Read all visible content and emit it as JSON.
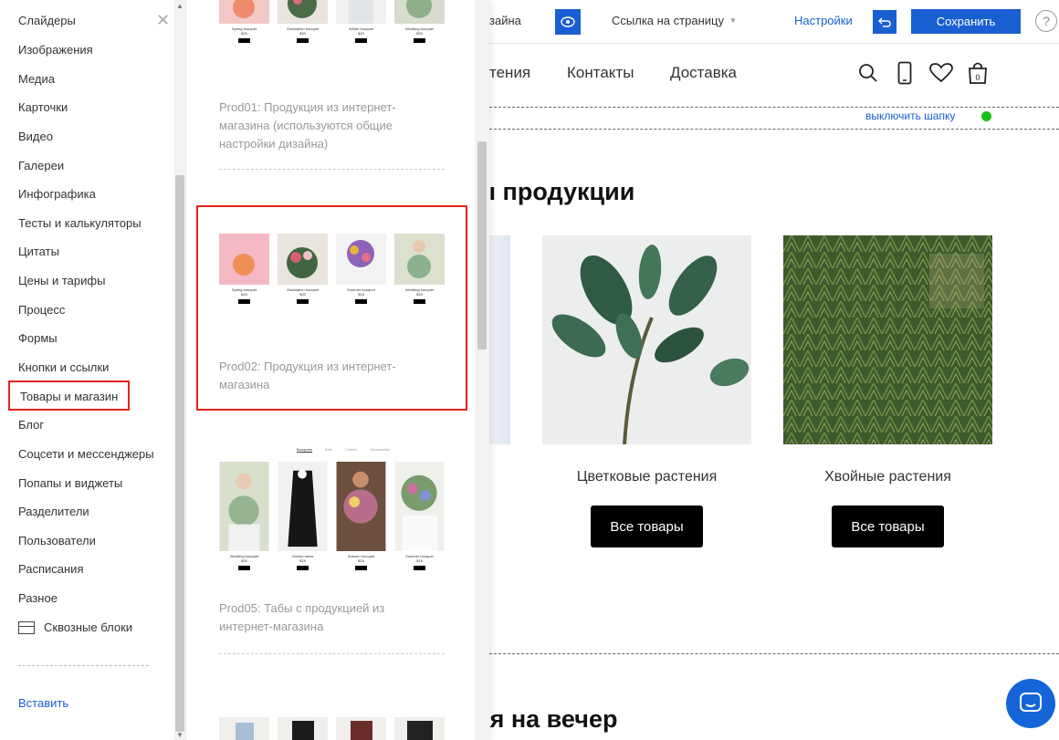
{
  "sidebar": {
    "categories": [
      "Слайдеры",
      "Изображения",
      "Медиа",
      "Карточки",
      "Видео",
      "Галереи",
      "Инфографика",
      "Тесты и калькуляторы",
      "Цитаты",
      "Цены и тарифы",
      "Процесс",
      "Формы",
      "Кнопки и ссылки",
      "Товары и магазин",
      "Блог",
      "Соцсети и мессенджеры",
      "Попапы и виджеты",
      "Разделители",
      "Пользователи",
      "Расписания",
      "Разное"
    ],
    "selected_category": "Товары и магазин",
    "through_blocks_label": "Сквозные блоки",
    "insert_label": "Вставить"
  },
  "panel": {
    "templates": [
      {
        "label": "Prod01: Продукция из интернет-магазина (используются общие настройки дизайна)",
        "items": [
          {
            "name": "Spring bouquet",
            "price": "$25"
          },
          {
            "name": "Graduation bouquet",
            "price": "$30"
          },
          {
            "name": "Winter bouquet",
            "price": "$20"
          },
          {
            "name": "Wedding bouquet",
            "price": "$30"
          }
        ]
      },
      {
        "label": "Prod02: Продукция из интернет-магазина",
        "items": [
          {
            "name": "Spring bouquet",
            "price": "$25"
          },
          {
            "name": "Graduation bouquet",
            "price": "$30"
          },
          {
            "name": "Summer bouquet",
            "price": "$18"
          },
          {
            "name": "Wedding bouquet",
            "price": "$30"
          }
        ]
      },
      {
        "label": "Prod05: Табы с продукцией из интернет-магазина",
        "tabs": [
          "Bouquets",
          "Sale",
          "Clothes",
          "Accessories"
        ],
        "items": [
          {
            "name": "Wedding bouquet",
            "price": "$30"
          },
          {
            "name": "Classic dress",
            "price": "$29"
          },
          {
            "name": "Autumn bouquet",
            "price": "$25"
          },
          {
            "name": "Summer bouquet",
            "price": "$18"
          }
        ]
      }
    ],
    "buy_label": "Buy"
  },
  "topbar": {
    "design_label": "зайна",
    "page_link": "Ссылка на страницу",
    "settings": "Настройки",
    "save": "Сохранить",
    "help": "?"
  },
  "site": {
    "nav": [
      "тения",
      "Контакты",
      "Доставка"
    ],
    "cart_count": "0",
    "header_toggle": "выключить шапку",
    "section1_title": "ы продукции",
    "products": [
      {
        "name": "Цветковые растения",
        "button": "Все товары"
      },
      {
        "name": "Хвойные растения",
        "button": "Все товары"
      }
    ],
    "section2_title": "ья на вечер"
  },
  "colors": {
    "accent": "#1a5fd1",
    "highlight": "#e2241f",
    "status_on": "#18c018"
  }
}
